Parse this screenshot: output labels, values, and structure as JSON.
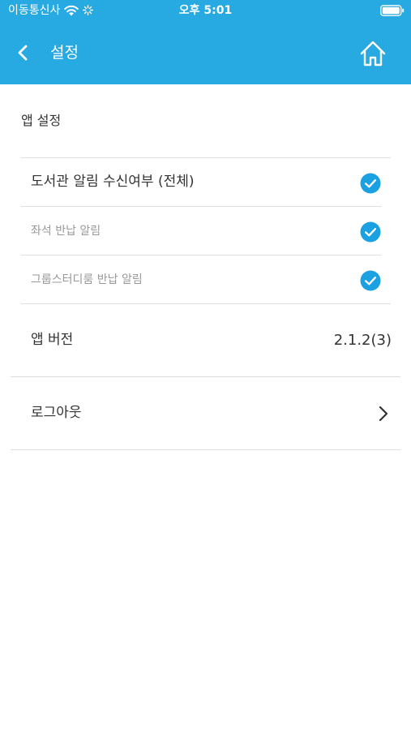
{
  "status_bar": {
    "carrier": "이동통신사",
    "time": "오후 5:01"
  },
  "nav": {
    "title": "설정"
  },
  "app_settings": {
    "section_title": "앱 설정",
    "items": [
      {
        "label": "도서관 알림 수신여부 (전체)",
        "checked": true
      },
      {
        "label": "좌석 반납 알림",
        "checked": true
      },
      {
        "label": "그룹스터디룸 반납 알림",
        "checked": true
      }
    ]
  },
  "version": {
    "label": "앱 버전",
    "value": "2.1.2(3)"
  },
  "logout": {
    "label": "로그아웃"
  },
  "colors": {
    "header_bg": "#27a9e1",
    "check_color": "#1ba1e2",
    "sub_text": "#999999"
  }
}
